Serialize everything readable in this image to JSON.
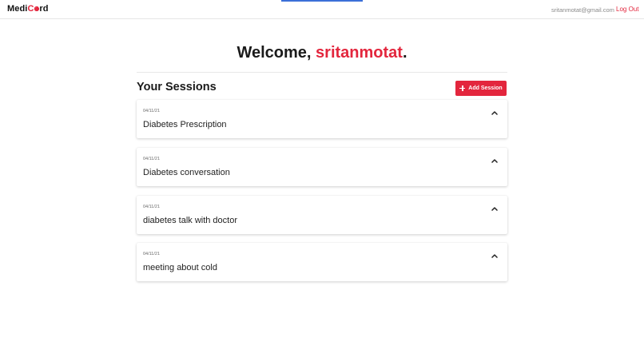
{
  "header": {
    "logo": {
      "part1": "Medi",
      "part2": "C",
      "part3": "o",
      "part4": "rd"
    },
    "email": "sritanmotat@gmail.com",
    "logout_label": "Log Out"
  },
  "welcome": {
    "prefix": "Welcome, ",
    "username": "sritanmotat",
    "suffix": "."
  },
  "sessions": {
    "heading": "Your Sessions",
    "add_label": "Add Session",
    "items": [
      {
        "date": "04/11/21",
        "title": "Diabetes Prescription"
      },
      {
        "date": "04/11/21",
        "title": "Diabetes conversation"
      },
      {
        "date": "04/11/21",
        "title": "diabetes talk with doctor"
      },
      {
        "date": "04/11/21",
        "title": "meeting about cold"
      }
    ]
  },
  "colors": {
    "accent": "#e3263d",
    "tab_indicator": "#3b6fd8"
  },
  "icons": {
    "add": "plus-icon",
    "expand": "chevron-up-icon"
  }
}
